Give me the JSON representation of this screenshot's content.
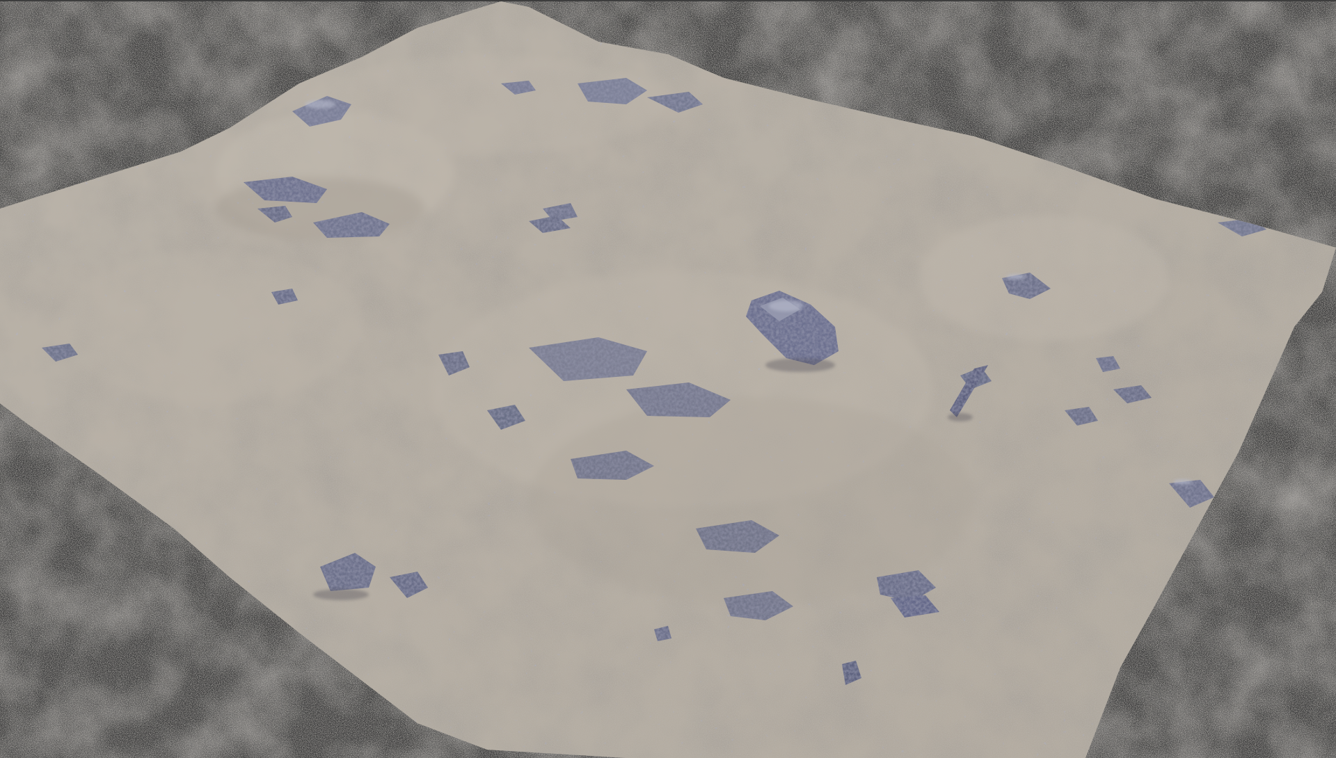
{
  "scene": {
    "subject": "terrain-mesh",
    "background_color": "#3d3d3d",
    "terrain_base_color": "#b9b1a6",
    "terrain_highlight_color": "#d4cdc3",
    "terrain_shadow_color": "#8c857c",
    "rock_color": "#767a92",
    "rock_dark_color": "#545872",
    "rock_light_color": "#9a9db2"
  }
}
